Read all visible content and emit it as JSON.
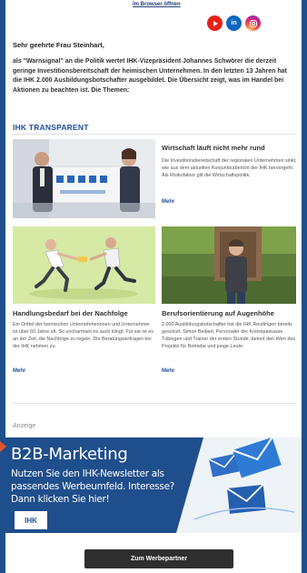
{
  "header": {
    "browser_link": "Im Browser öffnen",
    "social": [
      {
        "icon": "youtube-icon",
        "color": "#e62117"
      },
      {
        "icon": "linkedin-icon",
        "label": "in",
        "color": "#0a66c2"
      },
      {
        "icon": "instagram-icon",
        "color": "#d62976"
      }
    ]
  },
  "greeting": "Sehr geehrte Frau Steinhart,",
  "intro": "als \"Warnsignal\" an die Politik wertet IHK-Vizepräsident Johannes Schwörer die derzeit geringe Investitionsbereitschaft der heimischen Unternehmen. In den letzten 13 Jahren hat die IHK 2.000 Ausbildungsbotschafter ausgebildet. Die Übersicht zeigt, was im Handel bei Aktionen zu beachten ist. Die Themen:",
  "section_title": "IHK TRANSPARENT",
  "articles": [
    {
      "title": "Wirtschaft läuft nicht mehr rund",
      "text": "Die Investitionsbereitschaft der regionalen Unternehmen sinkt, wie aus dem aktuellen Konjunkturbericht der IHK hervorgeht. Als Risikofaktor gilt die Wirtschaftspolitik.",
      "more": "Mehr"
    },
    {
      "title": "Handlungsbedarf bei der Nachfolge",
      "text": "Ein Drittel der heimischen Unternehmerinnen und Unternehmer ist über 60 Jahre alt. So uncharmant es auch klingt: Für sie ist es an der Zeit, die Nachfolge zu regeln. Die Beratungsanfragen bei der IHK nehmen zu.",
      "more": "Mehr"
    },
    {
      "title": "Berufsorientierung auf Augenhöhe",
      "text": "2.000 Ausbildungsbotschafter hat die IHK Reutlingen bereits geschult. Simon Beilard, Personaler der Kreissparkasse Tübingen und Trainer der ersten Stunde, betont den Wert des Projekts für Betriebe und junge Leute.",
      "more": "Mehr"
    }
  ],
  "ad": {
    "label": "Anzeige",
    "title": "B2B-Marketing",
    "subtitle": "Nutzen Sie den IHK-Newsletter als passendes Werbeumfeld. Interesse? Dann klicken Sie hier!",
    "logo_text": "IHK",
    "button": "Zum Werbepartner",
    "colors": {
      "banner": "#1f4e8c",
      "accent": "#e2552c",
      "button": "#2f2f2f"
    }
  }
}
